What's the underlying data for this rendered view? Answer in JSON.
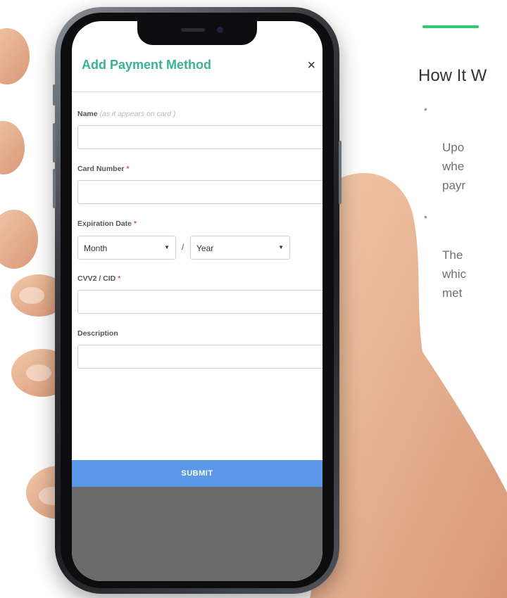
{
  "app": {
    "title": "Add Payment Method",
    "close_label": "×"
  },
  "form": {
    "name_label": "Name",
    "name_hint": "(as it appears on card )",
    "card_number_label": "Card Number",
    "expiration_label": "Expiration Date",
    "month_value": "Month",
    "year_value": "Year",
    "date_separator": "/",
    "cvv_label": "CVV2 / CID",
    "description_label": "Description",
    "required_mark": "*",
    "submit_label": "SUBMIT"
  },
  "how_it_works": {
    "title": "How It W",
    "items": [
      "Upo\nwhe\npayr",
      "The\nwhic\nmet"
    ],
    "bullet": "•"
  },
  "colors": {
    "accent_green": "#2ecc71",
    "title_teal": "#38b394",
    "submit_blue": "#5b99e8",
    "required_red": "#e05252"
  }
}
